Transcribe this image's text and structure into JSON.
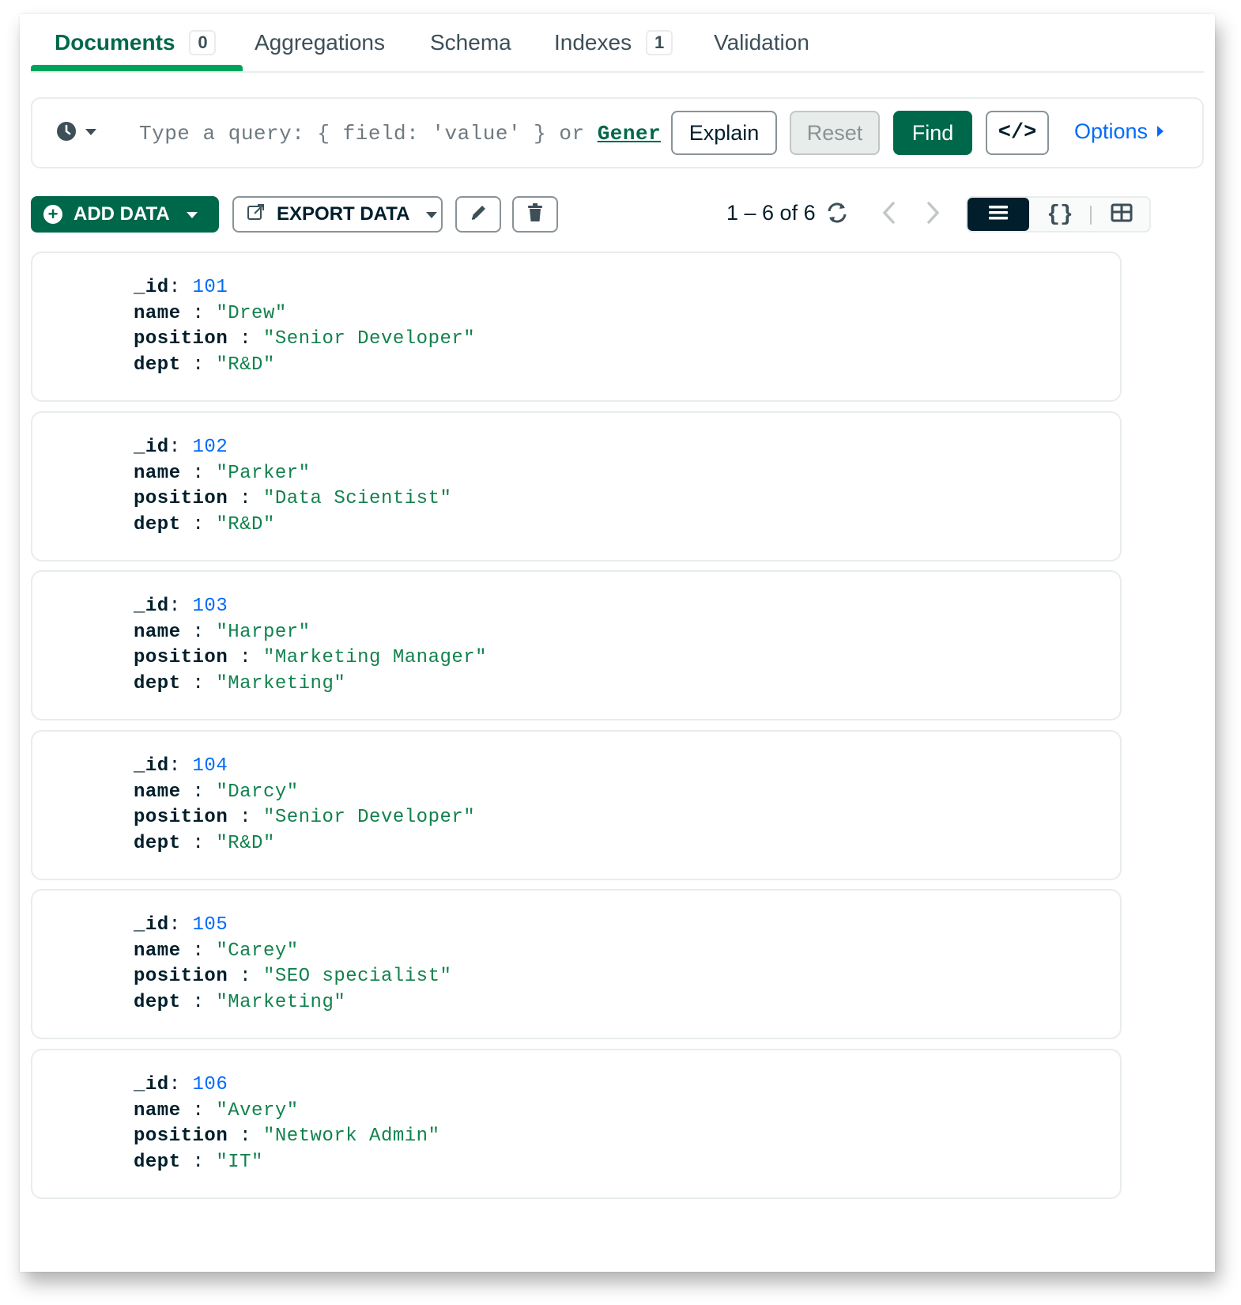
{
  "tabs": [
    {
      "label": "Documents",
      "badge": "0"
    },
    {
      "label": "Aggregations"
    },
    {
      "label": "Schema"
    },
    {
      "label": "Indexes",
      "badge": "1"
    },
    {
      "label": "Validation"
    }
  ],
  "query": {
    "placeholder_prefix": "Type a query: { field: 'value' } or ",
    "placeholder_link": "Gener",
    "explain": "Explain",
    "reset": "Reset",
    "find": "Find",
    "code_icon": "</>",
    "options": "Options"
  },
  "toolbar": {
    "add_data": "ADD DATA",
    "export_data": "EXPORT DATA",
    "pagination": "1 – 6 of 6",
    "json_view_icon": "{}"
  },
  "documents": [
    {
      "id": "101",
      "name": "\"Drew\"",
      "position": "\"Senior Developer\"",
      "dept": "\"R&D\""
    },
    {
      "id": "102",
      "name": "\"Parker\"",
      "position": "\"Data Scientist\"",
      "dept": "\"R&D\""
    },
    {
      "id": "103",
      "name": "\"Harper\"",
      "position": "\"Marketing Manager\"",
      "dept": "\"Marketing\""
    },
    {
      "id": "104",
      "name": "\"Darcy\"",
      "position": "\"Senior Developer\"",
      "dept": "\"R&D\""
    },
    {
      "id": "105",
      "name": "\"Carey\"",
      "position": "\"SEO specialist\"",
      "dept": "\"Marketing\""
    },
    {
      "id": "106",
      "name": "\"Avery\"",
      "position": "\"Network Admin\"",
      "dept": "\"IT\""
    }
  ],
  "field_labels": {
    "id": "_id",
    "name": "name",
    "position": "position",
    "dept": "dept"
  },
  "colors": {
    "accent": "#00684a",
    "tab_underline": "#00a35c",
    "link": "#016bf8",
    "string": "#12824d",
    "number": "#016bf8"
  }
}
